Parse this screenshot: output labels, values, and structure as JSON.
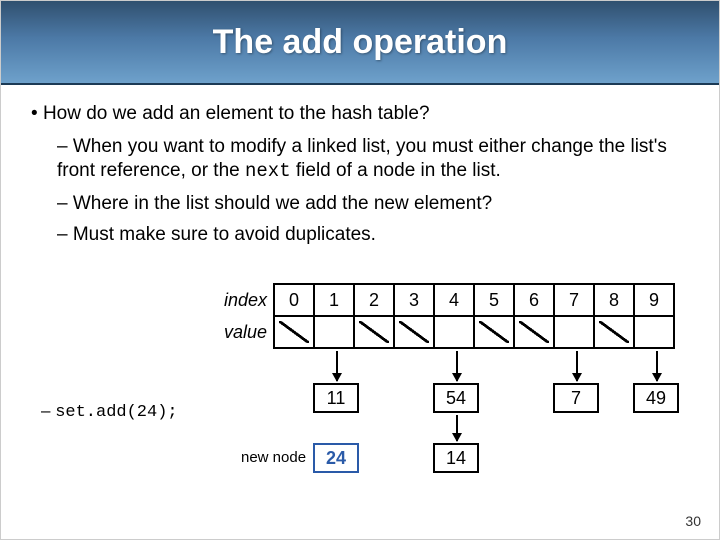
{
  "title": "The add operation",
  "bullet_main": "How do we add an element to the hash table?",
  "sub1_a": "When you want to modify a linked list, you must either change the list's front reference, or the ",
  "sub1_code": "next",
  "sub1_b": " field of a node in the list.",
  "sub2": "Where in the list should we add the new element?",
  "sub3": "Must make sure to avoid duplicates.",
  "table": {
    "row_index": "index",
    "row_value": "value",
    "cols": [
      "0",
      "1",
      "2",
      "3",
      "4",
      "5",
      "6",
      "7",
      "8",
      "9"
    ]
  },
  "nodes": {
    "n11": "11",
    "n54": "54",
    "n7": "7",
    "n49": "49",
    "n14": "14",
    "n24": "24"
  },
  "newnode_label": "new node",
  "code": "set.add(24);",
  "page": "30",
  "chart_data": {
    "type": "table",
    "title": "Hash table buckets (chained linked lists)",
    "bucket_count": 10,
    "indices": [
      0,
      1,
      2,
      3,
      4,
      5,
      6,
      7,
      8,
      9
    ],
    "buckets": {
      "0": [],
      "1": [
        11
      ],
      "2": [],
      "3": [],
      "4": [
        54,
        14
      ],
      "5": [],
      "6": [],
      "7": [
        7
      ],
      "8": [],
      "9": [
        49
      ]
    },
    "operation": {
      "method": "add",
      "value": 24,
      "target_bucket": 4
    },
    "new_node": 24
  }
}
